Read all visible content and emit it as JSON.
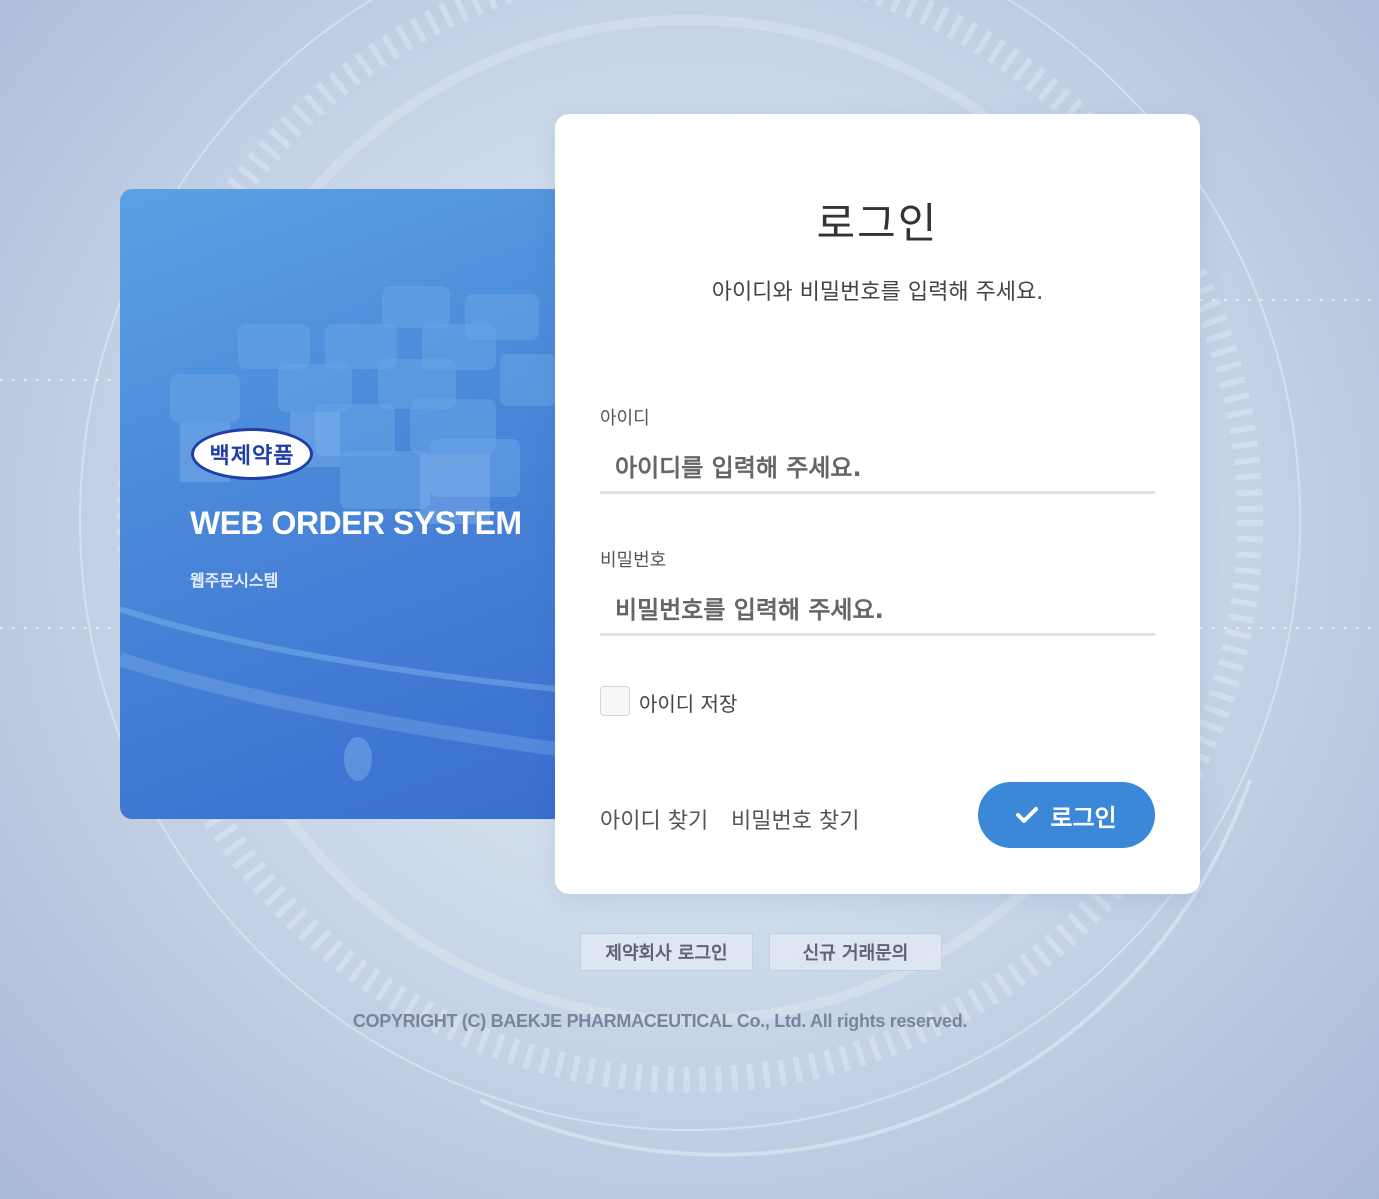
{
  "brand": {
    "logo_text": "백제약품",
    "title": "WEB ORDER SYSTEM",
    "subtitle": "웹주문시스템"
  },
  "login": {
    "title": "로그인",
    "subtitle": "아이디와 비밀번호를 입력해 주세요.",
    "id_label": "아이디",
    "id_placeholder": "아이디를 입력해 주세요.",
    "pw_label": "비밀번호",
    "pw_placeholder": "비밀번호를 입력해 주세요.",
    "remember_label": "아이디 저장",
    "remember_checked": false,
    "find_id": "아이디 찾기",
    "find_pw": "비밀번호 찾기",
    "submit": "로그인",
    "submit_icon": "check-icon"
  },
  "footer": {
    "pharma_login": "제약회사 로그인",
    "new_inquiry": "신규 거래문의",
    "copyright": "COPYRIGHT (C) BAEKJE PHARMACEUTICAL Co., Ltd. All rights reserved."
  },
  "colors": {
    "accent": "#3c88d8",
    "brand_panel": "#4a87d8",
    "logo_blue": "#1f3ea8"
  }
}
